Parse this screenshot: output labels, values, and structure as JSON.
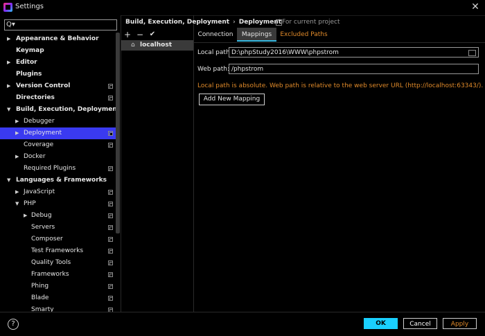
{
  "window": {
    "title": "Settings",
    "close_glyph": "✕"
  },
  "search": {
    "placeholder": "",
    "icon": "search-icon",
    "icon_glyph": "Q▾"
  },
  "tree": [
    {
      "label": "Appearance & Behavior",
      "bold": true,
      "indent": 0,
      "expand": "▶",
      "copy": false
    },
    {
      "label": "Keymap",
      "bold": true,
      "indent": 0,
      "expand": "",
      "copy": false
    },
    {
      "label": "Editor",
      "bold": true,
      "indent": 0,
      "expand": "▶",
      "copy": false
    },
    {
      "label": "Plugins",
      "bold": true,
      "indent": 0,
      "expand": "",
      "copy": false
    },
    {
      "label": "Version Control",
      "bold": true,
      "indent": 0,
      "expand": "▶",
      "copy": true
    },
    {
      "label": "Directories",
      "bold": true,
      "indent": 0,
      "expand": "",
      "copy": true
    },
    {
      "label": "Build, Execution, Deployment",
      "bold": true,
      "indent": 0,
      "expand": "▼",
      "copy": false
    },
    {
      "label": "Debugger",
      "bold": false,
      "indent": 1,
      "expand": "▶",
      "copy": false
    },
    {
      "label": "Deployment",
      "bold": false,
      "indent": 1,
      "expand": "▶",
      "copy": true,
      "selected": true
    },
    {
      "label": "Coverage",
      "bold": false,
      "indent": 1,
      "expand": "",
      "copy": true
    },
    {
      "label": "Docker",
      "bold": false,
      "indent": 1,
      "expand": "▶",
      "copy": false
    },
    {
      "label": "Required Plugins",
      "bold": false,
      "indent": 1,
      "expand": "",
      "copy": true
    },
    {
      "label": "Languages & Frameworks",
      "bold": true,
      "indent": 0,
      "expand": "▼",
      "copy": false
    },
    {
      "label": "JavaScript",
      "bold": false,
      "indent": 1,
      "expand": "▶",
      "copy": true
    },
    {
      "label": "PHP",
      "bold": false,
      "indent": 1,
      "expand": "▼",
      "copy": true
    },
    {
      "label": "Debug",
      "bold": false,
      "indent": 2,
      "expand": "▶",
      "copy": true
    },
    {
      "label": "Servers",
      "bold": false,
      "indent": 2,
      "expand": "",
      "copy": true
    },
    {
      "label": "Composer",
      "bold": false,
      "indent": 2,
      "expand": "",
      "copy": true
    },
    {
      "label": "Test Frameworks",
      "bold": false,
      "indent": 2,
      "expand": "",
      "copy": true
    },
    {
      "label": "Quality Tools",
      "bold": false,
      "indent": 2,
      "expand": "",
      "copy": true
    },
    {
      "label": "Frameworks",
      "bold": false,
      "indent": 2,
      "expand": "",
      "copy": true
    },
    {
      "label": "Phing",
      "bold": false,
      "indent": 2,
      "expand": "",
      "copy": true
    },
    {
      "label": "Blade",
      "bold": false,
      "indent": 2,
      "expand": "",
      "copy": true
    },
    {
      "label": "Smarty",
      "bold": false,
      "indent": 2,
      "expand": "",
      "copy": true
    }
  ],
  "server_toolbar": {
    "add": "+",
    "remove": "−",
    "check": "✔"
  },
  "servers": {
    "selected": "localhost",
    "icon": "home-icon"
  },
  "breadcrumb": {
    "part1": "Build, Execution, Deployment",
    "separator": "›",
    "part2": "Deployment"
  },
  "for_project": "For current project",
  "tabs": {
    "connection": "Connection",
    "mappings": "Mappings",
    "excluded": "Excluded Paths"
  },
  "mappings": {
    "local_path_label": "Local path:",
    "local_path_value": "D:\\phpStudy2016\\WWW\\phpstrom",
    "web_path_label": "Web path:",
    "web_path_value": "/phpstrom",
    "warning": "Local path is absolute. Web path is relative to the web server URL (http://localhost:63343/).",
    "add_button": "Add New Mapping"
  },
  "footer": {
    "help": "?",
    "ok": "OK",
    "cancel": "Cancel",
    "apply": "Apply"
  },
  "colors": {
    "accent": "#1ad0ff",
    "selection": "#3a3af0",
    "warning": "#e08a2a"
  }
}
